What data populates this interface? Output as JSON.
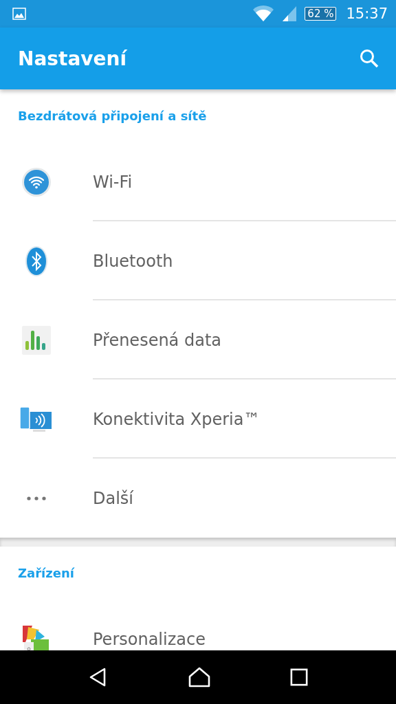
{
  "status_bar": {
    "battery": "62 %",
    "time": "15:37"
  },
  "app_bar": {
    "title": "Nastavení"
  },
  "sections": [
    {
      "title": "Bezdrátová připojení a sítě",
      "items": [
        {
          "kind": "wifi",
          "label": "Wi-Fi"
        },
        {
          "kind": "bluetooth",
          "label": "Bluetooth"
        },
        {
          "kind": "data",
          "label": "Přenesená data"
        },
        {
          "kind": "xperia",
          "label": "Konektivita Xperia™"
        },
        {
          "kind": "more",
          "label": "Další"
        }
      ]
    },
    {
      "title": "Zařízení",
      "items": [
        {
          "kind": "personalize",
          "label": "Personalizace"
        }
      ]
    }
  ]
}
